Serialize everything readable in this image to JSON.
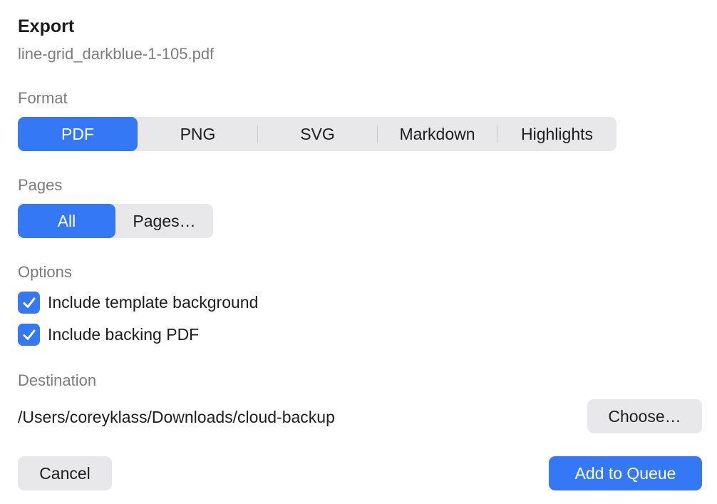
{
  "dialog": {
    "title": "Export",
    "filename": "line-grid_darkblue-1-105.pdf"
  },
  "format": {
    "label": "Format",
    "options": [
      "PDF",
      "PNG",
      "SVG",
      "Markdown",
      "Highlights"
    ],
    "selected": "PDF"
  },
  "pages": {
    "label": "Pages",
    "options": [
      "All",
      "Pages…"
    ],
    "selected": "All"
  },
  "options": {
    "label": "Options",
    "items": [
      {
        "label": "Include template background",
        "checked": true
      },
      {
        "label": "Include backing PDF",
        "checked": true
      }
    ]
  },
  "destination": {
    "label": "Destination",
    "path": "/Users/coreyklass/Downloads/cloud-backup",
    "choose_label": "Choose…"
  },
  "footer": {
    "cancel_label": "Cancel",
    "submit_label": "Add to Queue"
  },
  "colors": {
    "accent": "#3478f6",
    "control_bg": "#e8e8ea",
    "secondary_text": "#7c7c80"
  }
}
